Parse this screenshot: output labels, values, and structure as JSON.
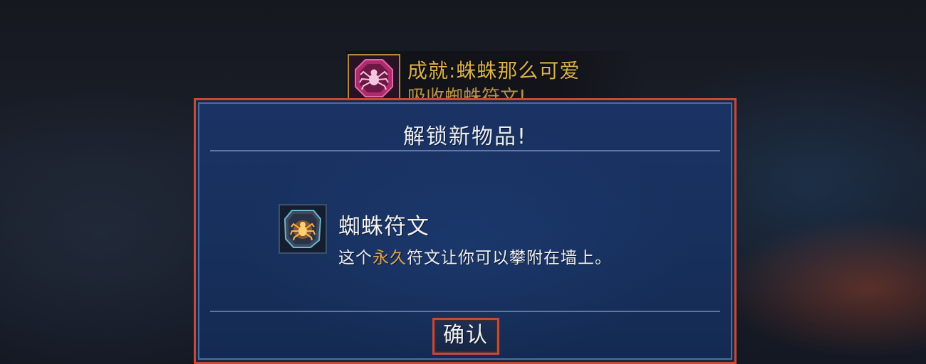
{
  "achievement": {
    "title": "成就:蛛蛛那么可爱",
    "description": "吸收蜘蛛符文!",
    "icon": "spider-badge-icon",
    "colors": {
      "title": "#d9b24e",
      "badge_border": "#b08a3a"
    }
  },
  "dialog": {
    "title": "解锁新物品!",
    "item": {
      "icon": "spider-rune-icon",
      "name": "蜘蛛符文",
      "description_parts": [
        "这个",
        "永久",
        "符文让你可以攀附在墙上。"
      ],
      "highlight_color": "#e0a650"
    },
    "confirm_label": "确认",
    "colors": {
      "border": "#c8483a",
      "panel": "#17305d",
      "divider": "#6f89b2"
    }
  }
}
